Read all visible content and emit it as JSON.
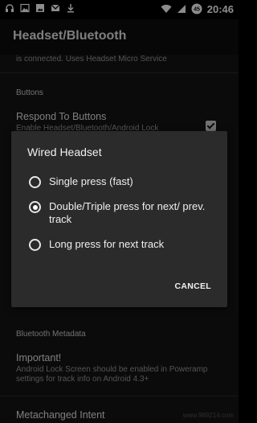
{
  "statusbar": {
    "time": "20:46",
    "left_icons": [
      "headset-icon",
      "image-icon",
      "gallery-icon",
      "mail-icon",
      "download-icon"
    ],
    "right_icons": [
      "wifi-icon",
      "signal-icon",
      "battery-icon"
    ],
    "battery_level": "45"
  },
  "appbar": {
    "title": "Headset/Bluetooth"
  },
  "settings": {
    "connected_summary": "is connected. Uses Headset Micro Service",
    "buttons_category": "Buttons",
    "respond_title": "Respond To Buttons",
    "respond_summary": "Enable Headset/Bluetooth/Android Lock",
    "bluetooth_category": "Bluetooth Metadata",
    "important_title": "Important!",
    "important_summary": "Android Lock Screen should be enabled in Poweramp settings for track info on Android 4.3+",
    "metachanged_title": "Metachanged Intent",
    "watermark": "www.989214.com"
  },
  "dialog": {
    "title": "Wired Headset",
    "options": [
      {
        "label": "Single press (fast)",
        "selected": false
      },
      {
        "label": "Double/Triple press for next/ prev. track",
        "selected": true
      },
      {
        "label": "Long press for next track",
        "selected": false
      }
    ],
    "cancel_label": "CANCEL"
  }
}
